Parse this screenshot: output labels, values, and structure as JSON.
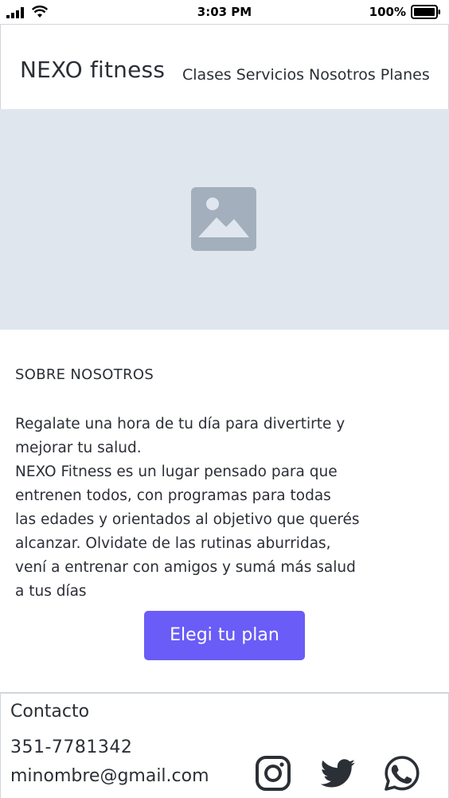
{
  "status_bar": {
    "time": "3:03 PM",
    "battery": "100%"
  },
  "header": {
    "brand": "NEXO fitness",
    "nav": [
      "Clases",
      "Servicios",
      "Nosotros",
      "Planes"
    ]
  },
  "hero": {
    "icon": "image-placeholder-icon"
  },
  "about": {
    "title": "SOBRE NOSOTROS",
    "lines": [
      "Regalate una hora de tu día para divertirte y",
      "mejorar tu salud.",
      "NEXO Fitness es un lugar pensado para que",
      "entrenen todos, con programas para todas",
      "las edades y orientados al objetivo que querés",
      "alcanzar. Olvidate de las rutinas aburridas,",
      "vení a entrenar con amigos y sumá más salud",
      "a tus días"
    ],
    "cta_label": "Elegi tu plan"
  },
  "footer": {
    "title": "Contacto",
    "phone": "351-7781342",
    "email": "minombre@gmail.com",
    "social": [
      "instagram-icon",
      "twitter-icon",
      "whatsapp-icon"
    ]
  },
  "colors": {
    "accent": "#6a5cf6",
    "hero_bg": "#e0e6ee",
    "icon": "#2b2f36",
    "placeholder_icon": "#a3afbd"
  }
}
